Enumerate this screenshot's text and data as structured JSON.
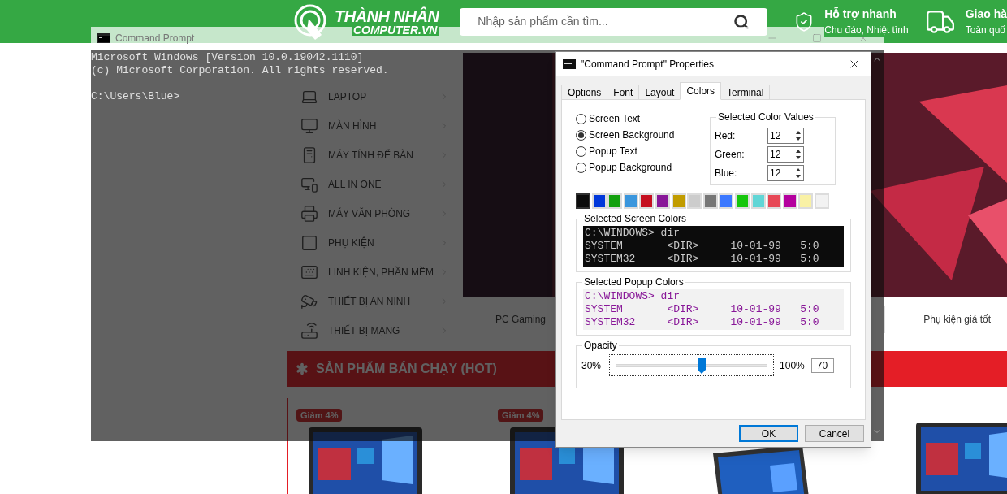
{
  "site": {
    "logo": {
      "line1": "THÀNH NHÂN",
      "line2": "COMPUTER.VN"
    },
    "search": {
      "placeholder": "Nhập sản phẩm cần tìm..."
    },
    "features": [
      {
        "kind": "shield",
        "title": "Hỗ trợ nhanh",
        "subtitle": "Chu đáo, Nhiệt tình"
      },
      {
        "kind": "truck",
        "title": "Giao hà",
        "subtitle": "Toàn quố"
      }
    ],
    "menu": [
      {
        "kind": "laptop",
        "label": "LAPTOP"
      },
      {
        "kind": "monitor",
        "label": "MÀN HÌNH"
      },
      {
        "kind": "desktop",
        "label": "MÁY TÍNH ĐỂ BÀN"
      },
      {
        "kind": "aio",
        "label": "ALL IN ONE"
      },
      {
        "kind": "printer",
        "label": "MÁY VĂN PHÒNG"
      },
      {
        "kind": "accessory",
        "label": "PHỤ KIỆN"
      },
      {
        "kind": "keyboard",
        "label": "LINH KIỆN, PHẦN MỀM"
      },
      {
        "kind": "camera",
        "label": "THIẾT BỊ AN NINH"
      },
      {
        "kind": "router",
        "label": "THIẾT BỊ MẠNG"
      }
    ],
    "banner_tabs": [
      "PC Gaming",
      "Phụ kiện giá tốt"
    ],
    "hot_title": "SẢN PHẨM BÁN CHẠY (HOT)",
    "products": [
      {
        "kind": "aio",
        "badge": "Giảm 4%"
      },
      {
        "kind": "aio",
        "badge": "Giảm 4%"
      },
      {
        "kind": "laptop"
      },
      {
        "kind": "aio"
      }
    ]
  },
  "cmd": {
    "title": "Command Prompt",
    "output": [
      "Microsoft Windows [Version 10.0.19042.1110]",
      "(c) Microsoft Corporation. All rights reserved."
    ],
    "prompt": "C:\\Users\\Blue>"
  },
  "dialog": {
    "title": "\"Command Prompt\" Properties",
    "tabs": [
      {
        "label": "Options",
        "selected": false
      },
      {
        "label": "Font",
        "selected": false
      },
      {
        "label": "Layout",
        "selected": false
      },
      {
        "label": "Colors",
        "selected": true
      },
      {
        "label": "Terminal",
        "selected": false
      }
    ],
    "radios": [
      {
        "label": "Screen Text",
        "selected": false
      },
      {
        "label": "Screen Background",
        "selected": true
      },
      {
        "label": "Popup Text",
        "selected": false
      },
      {
        "label": "Popup Background",
        "selected": false
      }
    ],
    "color_values": {
      "title": "Selected Color Values",
      "fields": [
        {
          "label": "Red:",
          "value": "12"
        },
        {
          "label": "Green:",
          "value": "12"
        },
        {
          "label": "Blue:",
          "value": "12"
        }
      ]
    },
    "palette": [
      {
        "color": "#0c0c0c",
        "selected": true
      },
      {
        "color": "#0037da",
        "selected": false
      },
      {
        "color": "#13a10e",
        "selected": false
      },
      {
        "color": "#3a96dd",
        "selected": false
      },
      {
        "color": "#c50f1f",
        "selected": false
      },
      {
        "color": "#881798",
        "selected": false
      },
      {
        "color": "#c19c00",
        "selected": false
      },
      {
        "color": "#cccccc",
        "selected": false
      },
      {
        "color": "#767676",
        "selected": false
      },
      {
        "color": "#3b78ff",
        "selected": false
      },
      {
        "color": "#16c60c",
        "selected": false
      },
      {
        "color": "#61d6d6",
        "selected": false
      },
      {
        "color": "#e74856",
        "selected": false
      },
      {
        "color": "#b4009e",
        "selected": false
      },
      {
        "color": "#f9f1a5",
        "selected": false
      },
      {
        "color": "#f2f2f2",
        "selected": false
      }
    ],
    "screen_preview": {
      "title": "Selected Screen Colors",
      "lines": [
        "C:\\WINDOWS> dir",
        "SYSTEM       <DIR>     10-01-99   5:0",
        "SYSTEM32     <DIR>     10-01-99   5:0"
      ]
    },
    "popup_preview": {
      "title": "Selected Popup Colors",
      "lines": [
        "C:\\WINDOWS> dir",
        "SYSTEM       <DIR>     10-01-99   5:0",
        "SYSTEM32     <DIR>     10-01-99   5:0"
      ]
    },
    "opacity": {
      "title": "Opacity",
      "min_label": "30%",
      "max_label": "100%",
      "level": 0.57,
      "value": "70"
    },
    "buttons": [
      {
        "label": "OK",
        "default": true
      },
      {
        "label": "Cancel",
        "default": false
      }
    ]
  }
}
